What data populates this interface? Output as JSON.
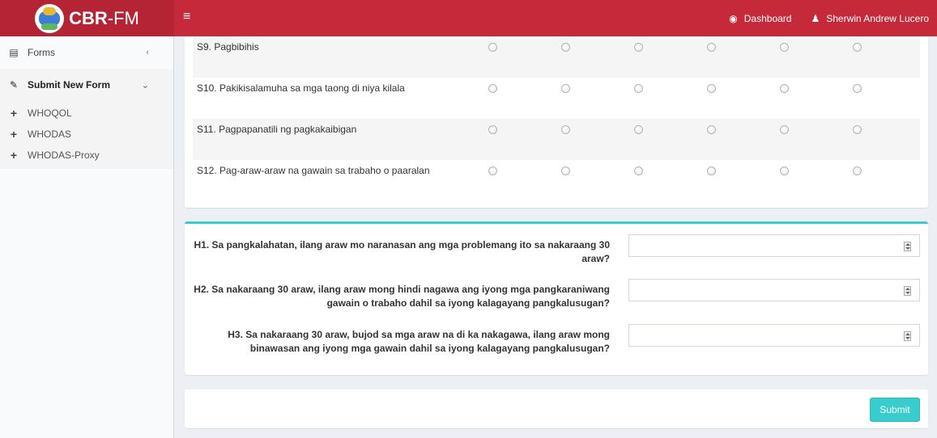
{
  "app": {
    "logo_bold": "CBR",
    "logo_rest": "-FM"
  },
  "topbar": {
    "menu_icon": "hamburger-icon",
    "dashboard_label": "Dashboard",
    "user_name": "Sherwin Andrew Lucero"
  },
  "sidebar": {
    "forms_label": "Forms",
    "submit_label": "Submit New Form",
    "sub_items": [
      "WHOQOL",
      "WHODAS",
      "WHODAS-Proxy"
    ]
  },
  "questions": [
    {
      "label": "S9. Pagbibihis"
    },
    {
      "label": "S10. Pakikisalamuha sa mga taong di niya kilala"
    },
    {
      "label": "S11. Pagpapanatili ng pagkakaibigan"
    },
    {
      "label": "S12. Pag-araw-araw na gawain sa trabaho o paaralan"
    }
  ],
  "health_questions": [
    {
      "label": "H1. Sa pangkalahatan, ilang araw mo naranasan ang mga problemang ito sa nakaraang 30 araw?",
      "value": ""
    },
    {
      "label": "H2. Sa nakaraang 30 araw, ilang araw mong hindi nagawa ang iyong mga pangkaraniwang gawain o trabaho dahil sa iyong kalagayang pangkalusugan?",
      "value": ""
    },
    {
      "label": "H3. Sa nakaraang 30 araw, bujod sa mga araw na di ka nakagawa, ilang araw mong binawasan ang iyong mga gawain dahil sa iyong kalagayang pangkalusugan?",
      "value": ""
    }
  ],
  "submit_label": "Submit",
  "colors": {
    "topbar": "#c62a3a",
    "accent": "#39cccc"
  }
}
